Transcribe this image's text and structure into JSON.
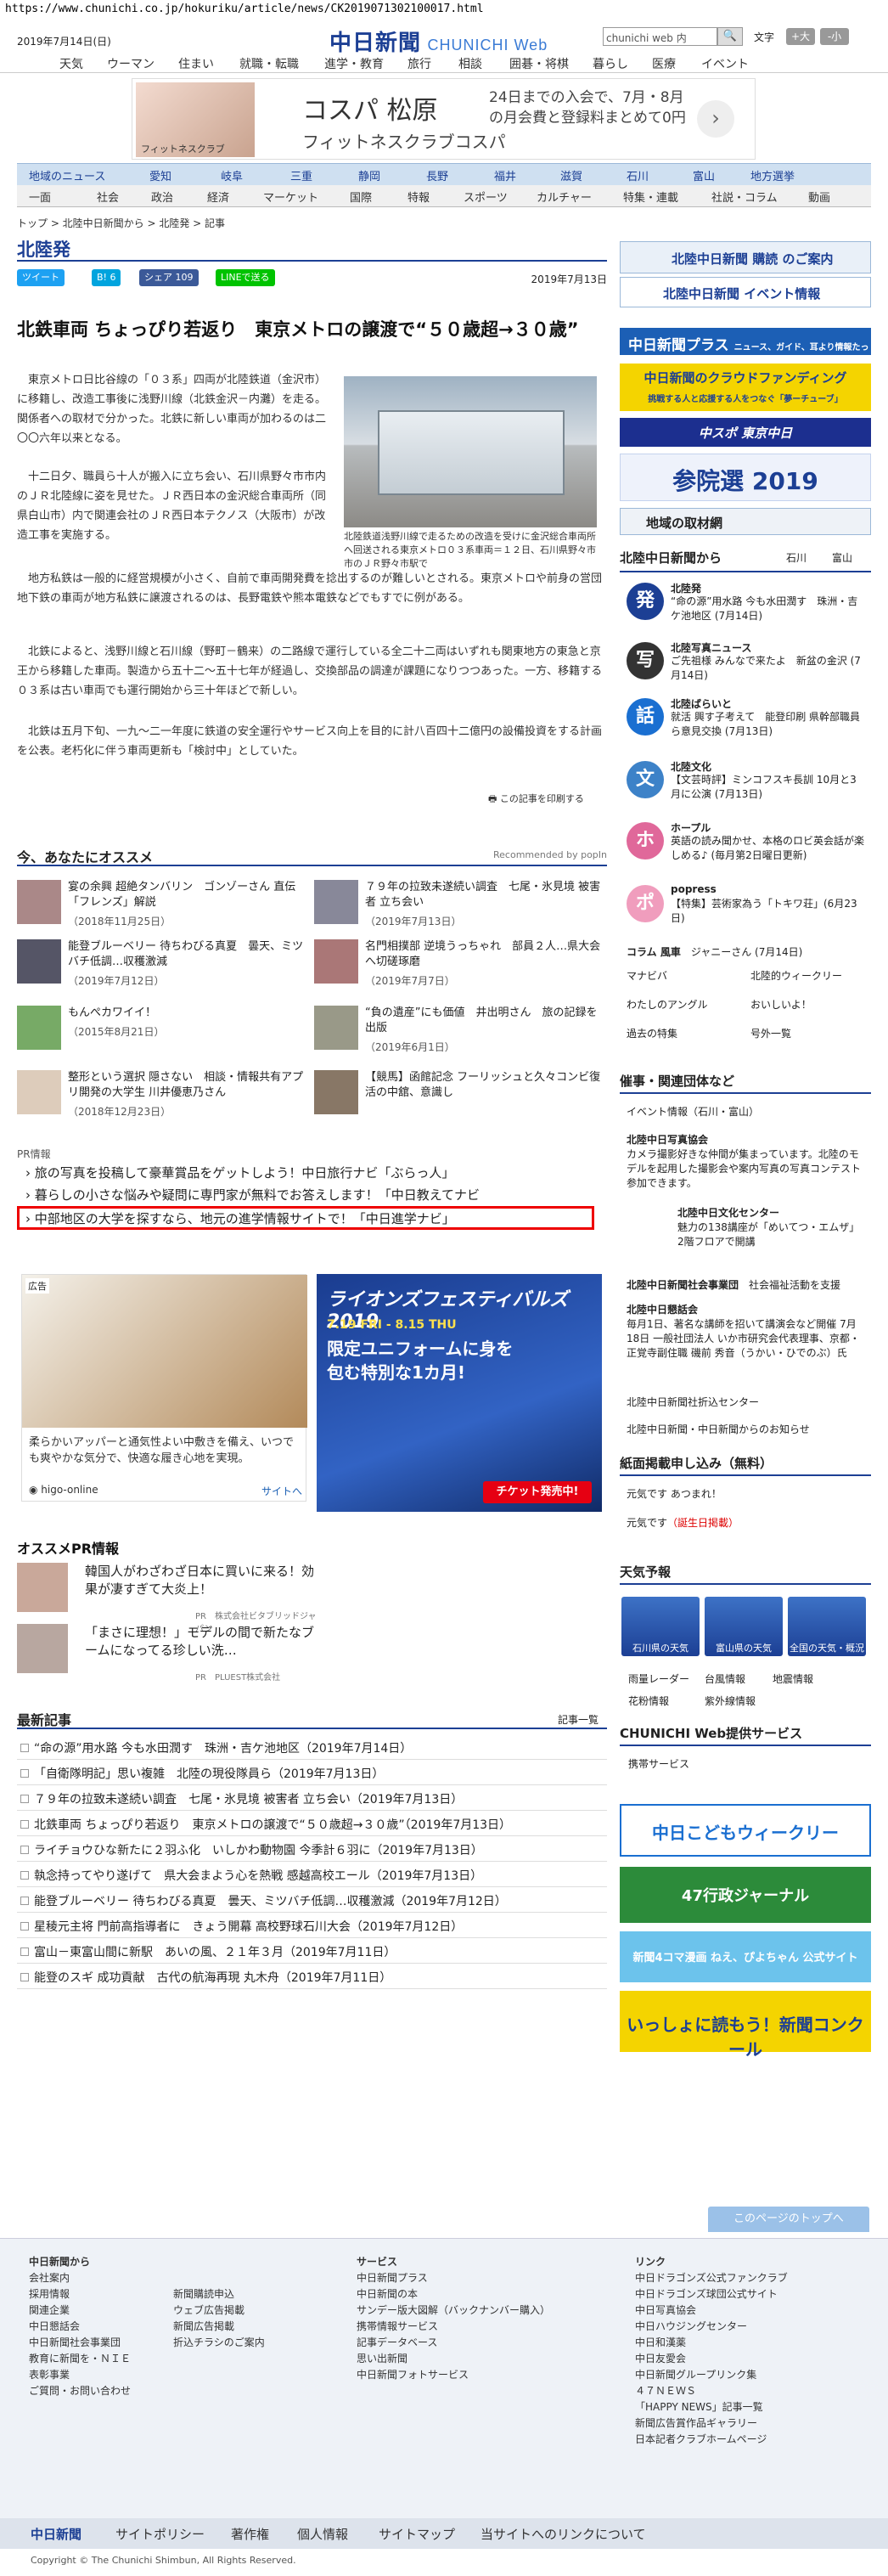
{
  "url": "https://www.chunichi.co.jp/hokuriku/article/news/CK2019071302100017.html",
  "header": {
    "date": "2019年7月14日(日)",
    "logo_main": "中日新聞",
    "logo_sub": "CHUNICHI Web",
    "search_placeholder": "chunichi web 内",
    "search_button": "🔍",
    "font_size_label": "文字",
    "font_plus": "+大",
    "font_minus": "-小"
  },
  "global_nav": [
    "天気",
    "ウーマン",
    "住まい",
    "就職・転職",
    "進学・教育",
    "旅行",
    "相談",
    "囲碁・将棋",
    "暮らし",
    "医療",
    "イベント"
  ],
  "top_ad": {
    "brand_small": "フィットネスクラブ",
    "title": "コスパ 松原",
    "subtitle": "フィットネスクラブコスパ",
    "copy": "24日までの入会で、7月・8月の月会費と登録料まとめて0円",
    "arrow": "›"
  },
  "region_nav": [
    "地域のニュース",
    "愛知",
    "岐阜",
    "三重",
    "静岡",
    "長野",
    "福井",
    "滋賀",
    "石川",
    "富山",
    "地方選挙"
  ],
  "category_nav": [
    "一面",
    "社会",
    "政治",
    "経済",
    "マーケット",
    "国際",
    "特報",
    "スポーツ",
    "カルチャー",
    "特集・連載",
    "社説・コラム",
    "動画"
  ],
  "breadcrumb": "トップ > 北陸中日新聞から > 北陸発 > 記事",
  "section_title": "北陸発",
  "share": {
    "tweet": "ツイート",
    "hatena": "B! 6",
    "fb_share": "シェア 109",
    "line": "LINEで送る"
  },
  "article": {
    "date": "2019年7月13日",
    "title": "北鉄車両 ちょっぴり若返り　東京メトロの譲渡で“５０歳超→３０歳”",
    "p1": "東京メトロ日比谷線の「０３系」四両が北陸鉄道（金沢市）に移籍し、改造工事後に浅野川線（北鉄金沢－内灘）を走る。関係者への取材で分かった。北鉄に新しい車両が加わるのは二〇〇六年以来となる。",
    "p2": "十二日夕、職員ら十人が搬入に立ち会い、石川県野々市市内のＪＲ北陸線に姿を見せた。ＪＲ西日本の金沢総合車両所（同県白山市）内で関連会社のＪＲ西日本テクノス（大阪市）が改造工事を実施する。",
    "p3": "地方私鉄は一般的に経営規模が小さく、自前で車両開発費を捻出するのが難しいとされる。東京メトロや前身の営団地下鉄の車両が地方私鉄に譲渡されるのは、長野電鉄や熊本電鉄などでもすでに例がある。",
    "p4": "北鉄によると、浅野川線と石川線（野町－鶴来）の二路線で運行している全二十二両はいずれも関東地方の東急と京王から移籍した車両。製造から五十二～五十七年が経過し、交換部品の調達が課題になりつつあった。一方、移籍する０３系は古い車両でも運行開始から三十年ほどで新しい。",
    "p5": "北鉄は五月下旬、一九～二一年度に鉄道の安全運行やサービス向上を目的に計八百四十二億円の設備投資をする計画を公表。老朽化に伴う車両更新も「検討中」としていた。",
    "caption": "北陸鉄道浅野川線で走るための改造を受けに金沢総合車両所へ回送される東京メトロ０３系車両＝１２日、石川県野々市市のＪＲ野々市駅で",
    "print": "この記事を印刷する"
  },
  "recommend": {
    "title": "今、あなたにオススメ",
    "by": "Recommended by popIn",
    "items": [
      {
        "title": "宴の余興 超絶タンバリン　ゴンゾーさん 直伝「フレンズ」解説",
        "date": "（2018年11月25日）"
      },
      {
        "title": "７９年の拉致未遂続い調査　七尾・氷見境 被害者 立ち会い",
        "date": "（2019年7月13日）"
      },
      {
        "title": "能登ブルーベリー 待ちわびる真夏　曇天、ミツバチ低調…収穫激減",
        "date": "（2019年7月12日）"
      },
      {
        "title": "名門相撲部 逆境うっちゃれ　部員２人…県大会へ切磋琢磨",
        "date": "（2019年7月7日）"
      },
      {
        "title": "もんぺカワイイ！",
        "date": "（2015年8月21日）"
      },
      {
        "title": "“負の遺産”にも価値　井出明さん　旅の記録を出版",
        "date": "（2019年6月1日）"
      },
      {
        "title": "整形という選択 隠さない　相談・情報共有アプリ開発の大学生 川井優恵乃さん",
        "date": "（2018年12月23日）"
      },
      {
        "title": "【競馬】函館記念 フーリッシュと久々コンビ復活の中舘、意識し",
        "date": ""
      }
    ]
  },
  "pr": {
    "label": "PR情報",
    "links": [
      "旅の写真を投稿して豪華賞品をゲットしよう！中日旅行ナビ「ぶらっ人」",
      "暮らしの小さな悩みや疑問に専門家が無料でお答えします！「中日教えてナビ",
      "中部地区の大学を探すなら、地元の進学情報サイトで！「中日進学ナビ」"
    ]
  },
  "ad_left": {
    "label": "広告",
    "text": "柔らかいアッパーと通気性よい中敷きを備え、いつでも爽やかな気分で、快適な履き心地を実現。",
    "source": "higo-online",
    "more": "サイトへ"
  },
  "ad_right": {
    "title": "ライオンズフェスティバルズ2019",
    "dates": "7.19 FRI - 8.15 THU",
    "copy": "限定ユニフォームに身を包む特別な1カ月!",
    "button": "チケット発売中!"
  },
  "osusume_pr": {
    "title": "オススメPR情報",
    "items": [
      {
        "title": "韓国人がわざわざ日本に買いに来る！効果が凄すぎて大炎上！",
        "by": "PR　株式会社ビタブリッドジャパン"
      },
      {
        "title": "「まさに理想！」モデルの間で新たなブームになってる珍しい洗…",
        "by": "PR　PLUEST株式会社"
      }
    ]
  },
  "latest": {
    "title": "最新記事",
    "all": "記事一覧",
    "items": [
      "“命の源”用水路 今も水田潤す　珠洲・吉ケ池地区（2019年7月14日）",
      "「自衛隊明記」思い複雑　北陸の現役隊員ら（2019年7月13日）",
      "７９年の拉致未遂続い調査　七尾・氷見境 被害者 立ち会い（2019年7月13日）",
      "北鉄車両 ちょっぴり若返り　東京メトロの譲渡で“５０歳超→３０歳”（2019年7月13日）",
      "ライチョウひな新たに２羽ふ化　いしかわ動物園 今季計６羽に（2019年7月13日）",
      "執念持ってやり遂げて　県大会まよう心を熱戦 感越高校エール（2019年7月13日）",
      "能登ブルーベリー 待ちわびる真夏　曇天、ミツバチ低調…収穫激減（2019年7月12日）",
      "星稜元主将 門前高指導者に　きょう開幕 高校野球石川大会（2019年7月12日）",
      "富山－東富山間に新駅　あいの風、２１年３月（2019年7月11日）",
      "能登のスギ 成功貢献　古代の航海再現 丸木舟（2019年7月11日）"
    ]
  },
  "right": {
    "subscribe": "北陸中日新聞 購読 のご案内",
    "event": "北陸中日新聞 イベント情報",
    "plus": "中日新聞プラス",
    "plus_sub": "ニュース、ガイド、耳より情報たっぷりさん",
    "crowdfunding": "中日新聞のクラウドファンディング",
    "crowd_sub": "挑戦する人と応援する人をつなぐ「夢ーチューブ」",
    "chuspo": "中スポ 東京中日",
    "sanin": "参院選 2019",
    "region_news": "地域の取材網",
    "hokuriku_title": "北陸中日新聞から",
    "hokuriku_tabs": [
      "石川",
      "富山"
    ],
    "sections": [
      {
        "icon": "発",
        "color": "#1c3f94",
        "name": "北陸発",
        "text": "“命の源”用水路 今も水田潤す　珠洲・吉ケ池地区 (7月14日)"
      },
      {
        "icon": "写",
        "color": "#333",
        "name": "北陸写真ニュース",
        "text": "ご先祖様 みんなで来たよ　新盆の金沢 (7月14日)"
      },
      {
        "icon": "話",
        "color": "#1a6fd1",
        "name": "北陸ばらいと",
        "text": "就活 興す子考えて　能登印刷 県幹部職員ら意見交換 (7月13日)"
      },
      {
        "icon": "文",
        "color": "#3d82c8",
        "name": "北陸文化",
        "text": "【文芸時評】ミンコフスキ長訓 10月と3月に公演 (7月13日)"
      },
      {
        "icon": "ホ",
        "color": "#e0689a",
        "name": "ホープル",
        "text": "英語の読み聞かせ、本格のロビ英会話が楽しめる♪ (毎月第2日曜日更新)"
      },
      {
        "icon": "ポ",
        "color": "#f09dbd",
        "name": "popress",
        "text": "【特集】芸術家為う「トキワ荘」(6月23日)"
      }
    ],
    "column_label": "コラム 風車",
    "column_text": "ジャニーさん (7月14日)",
    "links_grid": [
      "マナビバ",
      "北陸的ウィークリー",
      "わたしのアングル",
      "おいしいよ！",
      "過去の特集",
      "号外一覧"
    ],
    "event_title": "催事・関連団体など",
    "event_item": "イベント情報（石川・富山）",
    "events": [
      {
        "name": "北陸中日写真協会",
        "text": "カメラ撮影好きな仲間が集まっています。北陸のモデルを起用した撮影会や案内写真の写真コンテスト参加できます。"
      },
      {
        "name": "北陸中日文化センター",
        "text": "魅力の138講座が「めいてつ・エムザ」2階フロアで開講"
      },
      {
        "name": "北陸中日新聞社会事業団",
        "text": "社会福祉活動を支援"
      },
      {
        "name": "北陸中日懇話会",
        "text": "毎月1日、著名な講師を招いて講演会など開催 7月18日 一般社団法人 いか市研究会代表理事、京都・正覚寺副住職 磯前 秀音（うかい・ひでのぶ）氏"
      }
    ],
    "link_a": "北陸中日新聞社折込センター",
    "link_b": "北陸中日新聞・中日新聞からのお知らせ",
    "apply_title": "紙面掲載申し込み（無料）",
    "apply_a": "元気です あつまれ！",
    "apply_b": "元気です",
    "apply_b_tag": "（誕生日掲載）",
    "weather_title": "天気予報",
    "weather": [
      "石川県の天気",
      "富山県の天気",
      "全国の天気・概況"
    ],
    "weather_links": [
      "雨量レーダー",
      "台風情報",
      "地震情報",
      "花粉情報",
      "紫外線情報"
    ],
    "service_title": "CHUNICHI Web提供サービス",
    "service_item": "携帯サービス",
    "banner_kodomo": "中日こどもウィークリー",
    "banner_47": "47行政ジャーナル",
    "banner_4koma": "新聞4コマ漫画 ねえ、ぴよちゃん 公式サイト",
    "banner_nie": "いっしょに読もう！新聞コンクール"
  },
  "to_top": "このページのトップへ",
  "footer": {
    "col1_title": "中日新聞から",
    "col1": [
      "会社案内",
      "採用情報",
      "関連企業",
      "中日懇話会",
      "中日新聞社会事業団",
      "教育に新聞を・ＮＩＥ",
      "表彰事業",
      "ご質問・お問い合わせ"
    ],
    "col2": [
      "新聞購読申込",
      "ウェブ広告掲載",
      "新聞広告掲載",
      "折込チラシのご案内"
    ],
    "col3_title": "サービス",
    "col3": [
      "中日新聞プラス",
      "中日新聞の本",
      "サンデー版大図解（バックナンバー購入）",
      "携帯情報サービス",
      "記事データベース",
      "思い出新聞",
      "中日新聞フォトサービス"
    ],
    "col4_title": "リンク",
    "col4": [
      "中日ドラゴンズ公式ファンクラブ",
      "中日ドラゴンズ球団公式サイト",
      "中日写真協会",
      "中日ハウジングセンター",
      "中日和漢薬",
      "中日友愛会",
      "中日新聞グループリンク集",
      "４７ＮＥＷＳ",
      "「HAPPY NEWS」記事一覧",
      "新聞広告賞作品ギャラリー",
      "日本記者クラブホームページ"
    ],
    "bar_logo": "中日新聞",
    "bar": [
      "サイトポリシー",
      "著作権",
      "個人情報",
      "サイトマップ",
      "当サイトへのリンクについて"
    ],
    "copyright": "Copyright © The Chunichi Shimbun, All Rights Reserved."
  }
}
